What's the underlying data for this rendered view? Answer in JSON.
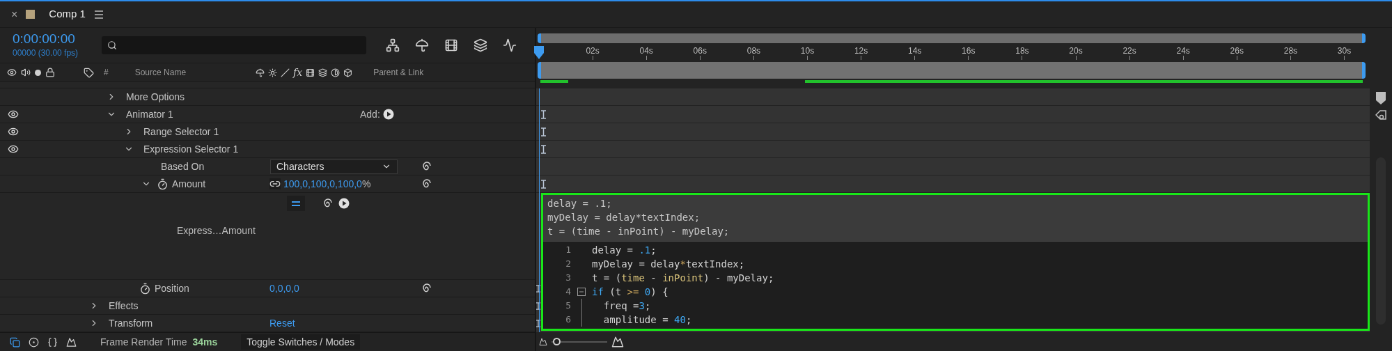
{
  "tab": {
    "close": "×",
    "title": "Comp 1"
  },
  "timecode": "0:00:00:00",
  "frame_info": "00000 (30.00 fps)",
  "columns": {
    "number": "#",
    "source": "Source Name",
    "switch_fx": "fx",
    "parent": "Parent & Link"
  },
  "text_properties": [
    {
      "kind": "group",
      "label": "More Options",
      "expanded": false,
      "eye": false,
      "track_marker": false
    },
    {
      "kind": "group",
      "label": "Animator 1",
      "expanded": true,
      "eye": true,
      "track_marker": true,
      "add_label": "Add:",
      "children": [
        {
          "kind": "group",
          "label": "Range Selector 1",
          "expanded": false,
          "eye": true,
          "track_marker": true
        },
        {
          "kind": "group",
          "label": "Expression Selector 1",
          "expanded": true,
          "eye": true,
          "track_marker": true,
          "children": [
            {
              "kind": "dropdown",
              "label": "Based On",
              "value": "Characters",
              "eye": false,
              "track_marker": false
            },
            {
              "kind": "property",
              "label": "Amount",
              "expanded": true,
              "value": "100,0,100,0,100,0",
              "unit": "%",
              "linked": true,
              "eye": false,
              "track_marker": true,
              "children": [
                {
                  "kind": "expression",
                  "label": "Express…Amount",
                  "enabled": true,
                  "eye": false,
                  "track_marker": false
                }
              ]
            }
          ]
        },
        {
          "kind": "property",
          "label": "Position",
          "value": "0,0,0,0",
          "linked": false,
          "eye": false,
          "track_marker": true
        }
      ]
    }
  ],
  "layer_groups": [
    {
      "kind": "group",
      "label": "Effects",
      "expanded": false,
      "eye": false,
      "track_marker": true
    },
    {
      "kind": "group",
      "label": "Transform",
      "expanded": false,
      "eye": false,
      "track_marker": true,
      "link": "Reset"
    }
  ],
  "ruler": {
    "ticks": [
      "02s",
      "04s",
      "06s",
      "08s",
      "10s",
      "12s",
      "14s",
      "16s",
      "18s",
      "20s",
      "22s",
      "24s",
      "26s",
      "28s",
      "30s"
    ]
  },
  "expression_preview": [
    "delay = .1;",
    "myDelay = delay*textIndex;",
    "t = (time - inPoint) - myDelay;"
  ],
  "code_editor": [
    {
      "number": "1",
      "foldable": false,
      "in_block": false,
      "tokens": [
        {
          "t": "delay = "
        },
        {
          "t": ".1",
          "kind": "number"
        },
        {
          "t": ";"
        }
      ]
    },
    {
      "number": "2",
      "foldable": false,
      "in_block": false,
      "tokens": [
        {
          "t": "myDelay = delay"
        },
        {
          "t": "*",
          "kind": "operator"
        },
        {
          "t": "textIndex;"
        }
      ]
    },
    {
      "number": "3",
      "foldable": false,
      "in_block": false,
      "tokens": [
        {
          "t": "t = ("
        },
        {
          "t": "time",
          "kind": "builtin"
        },
        {
          "t": " - "
        },
        {
          "t": "inPoint",
          "kind": "builtin"
        },
        {
          "t": ") - myDelay;"
        }
      ]
    },
    {
      "number": "4",
      "foldable": true,
      "in_block": false,
      "tokens": [
        {
          "t": "if",
          "kind": "keyword"
        },
        {
          "t": " (t "
        },
        {
          "t": ">=",
          "kind": "operator"
        },
        {
          "t": " 0",
          "kind": "number"
        },
        {
          "t": ") {"
        }
      ]
    },
    {
      "number": "5",
      "foldable": false,
      "in_block": true,
      "tokens": [
        {
          "t": "  freq ="
        },
        {
          "t": "3",
          "kind": "number"
        },
        {
          "t": ";"
        }
      ]
    },
    {
      "number": "6",
      "foldable": false,
      "in_block": true,
      "tokens": [
        {
          "t": "  amplitude = "
        },
        {
          "t": "40",
          "kind": "number"
        },
        {
          "t": ";"
        }
      ]
    }
  ],
  "status_bar": {
    "label": "Frame Render Time",
    "value": "34ms",
    "toggle": "Toggle Switches / Modes"
  },
  "zoom_slider": {
    "level": 0.05
  }
}
